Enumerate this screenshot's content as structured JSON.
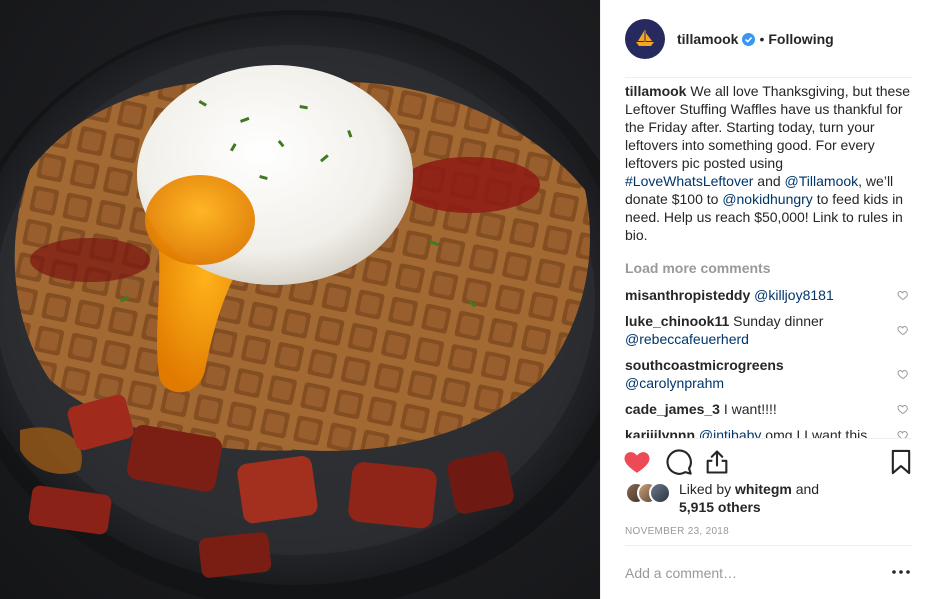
{
  "post": {
    "photo_description_icon": "food-photo"
  },
  "header": {
    "avatar_icon": "ship-logo-icon",
    "username": "tillamook",
    "verified_icon": "verified-badge-icon",
    "separator": "•",
    "follow_status": "Following"
  },
  "caption": {
    "username": "tillamook",
    "text_1": "We all love Thanksgiving, but these Leftover Stuffing Waffles have us thankful for the Friday after. Starting today, turn your leftovers into something good. For every leftovers pic posted using ",
    "hashtag": "#LoveWhatsLeftover",
    "text_2": " and ",
    "mention_1": "@Tillamook",
    "text_3": ", we’ll donate $100 to ",
    "mention_2": "@nokidhungry",
    "text_4": " to feed kids in need. Help us reach $50,000! Link to rules in bio."
  },
  "load_more": "Load more comments",
  "comments": [
    {
      "username": "misanthropisteddy",
      "mention": "@killjoy8181",
      "text": ""
    },
    {
      "username": "luke_chinook11",
      "text_before": " Sunday dinner",
      "mention": "@rebeccafeuerherd",
      "text": ""
    },
    {
      "username": "southcoastmicrogreens",
      "mention": "@carolynprahm",
      "text": ""
    },
    {
      "username": "cade_james_3",
      "text": " I want!!!!"
    },
    {
      "username": "kariiilynnn",
      "mention": "@intibaby",
      "text": " omg I I want this"
    }
  ],
  "actions": {
    "like_icon": "heart-filled-icon",
    "comment_icon": "comment-icon",
    "share_icon": "share-icon",
    "save_icon": "bookmark-icon",
    "liked_color": "#ed4956"
  },
  "likes": {
    "prefix": "Liked by ",
    "user": "whitegm",
    "middle": " and",
    "others": "5,915 others"
  },
  "date": "NOVEMBER 23, 2018",
  "add_comment": {
    "placeholder": "Add a comment…",
    "more_icon": "more-options-icon"
  }
}
